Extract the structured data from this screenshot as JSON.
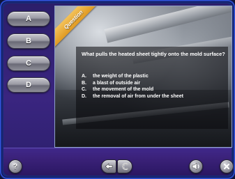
{
  "answers": [
    {
      "label": "A"
    },
    {
      "label": "B"
    },
    {
      "label": "C"
    },
    {
      "label": "D"
    }
  ],
  "panel": {
    "ribbon_label": "Question",
    "question": "What pulls the heated sheet tightly onto the mold surface?",
    "options": [
      {
        "letter": "A.",
        "text": "the weight of the plastic"
      },
      {
        "letter": "B.",
        "text": "a blast of outside air"
      },
      {
        "letter": "C.",
        "text": "the movement of the mold"
      },
      {
        "letter": "D.",
        "text": "the removal of air from under the sheet"
      }
    ]
  },
  "controls": {
    "help_label": "?",
    "back_icon": "arrow-left-icon",
    "replay_icon": "replay-icon",
    "audio_icon": "speaker-icon",
    "close_icon": "close-icon"
  },
  "colors": {
    "ribbon": "#e8a83a",
    "frame_border": "#2c4ac8",
    "background": "#3a2580"
  }
}
